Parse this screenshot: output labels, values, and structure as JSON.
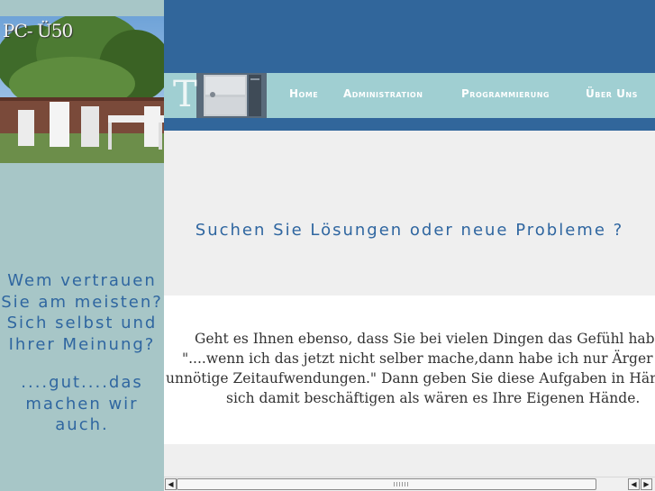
{
  "sidebar": {
    "photo_label": "PC- Ü50",
    "quote_1_lines": [
      "Wem vertrauen",
      "Sie am meisten?",
      "Sich selbst und",
      "Ihrer Meinung?"
    ],
    "quote_2_lines": [
      "....gut....das",
      "machen wir",
      "auch."
    ]
  },
  "header": {
    "logo_letter": "T",
    "nav": [
      {
        "label": "Home"
      },
      {
        "label": "Administration"
      },
      {
        "label": "Programmierung"
      },
      {
        "label": "Über Uns"
      }
    ]
  },
  "main": {
    "headline": "Suchen Sie Lösungen oder neue Probleme ?",
    "body_lines": [
      "Geht es Ihnen ebenso, dass Sie bei vielen Dingen das Gefühl haben",
      "\"....wenn ich das jetzt nicht selber mache,dann habe ich nur Ärger u",
      "unnötige Zeitaufwendungen.\" Dann geben Sie diese Aufgaben in Händ",
      "sich damit beschäftigen als wären es Ihre Eigenen Hände."
    ]
  },
  "colors": {
    "header_blue": "#31669b",
    "navbar_teal": "#a0cfd2",
    "sidebar_teal": "#a7c6c7",
    "text_blue": "#2f66a0"
  },
  "icons": [
    "scroll-left-arrow-icon",
    "scroll-right-arrow-icon",
    "scroll-left-small-arrow-icon"
  ]
}
